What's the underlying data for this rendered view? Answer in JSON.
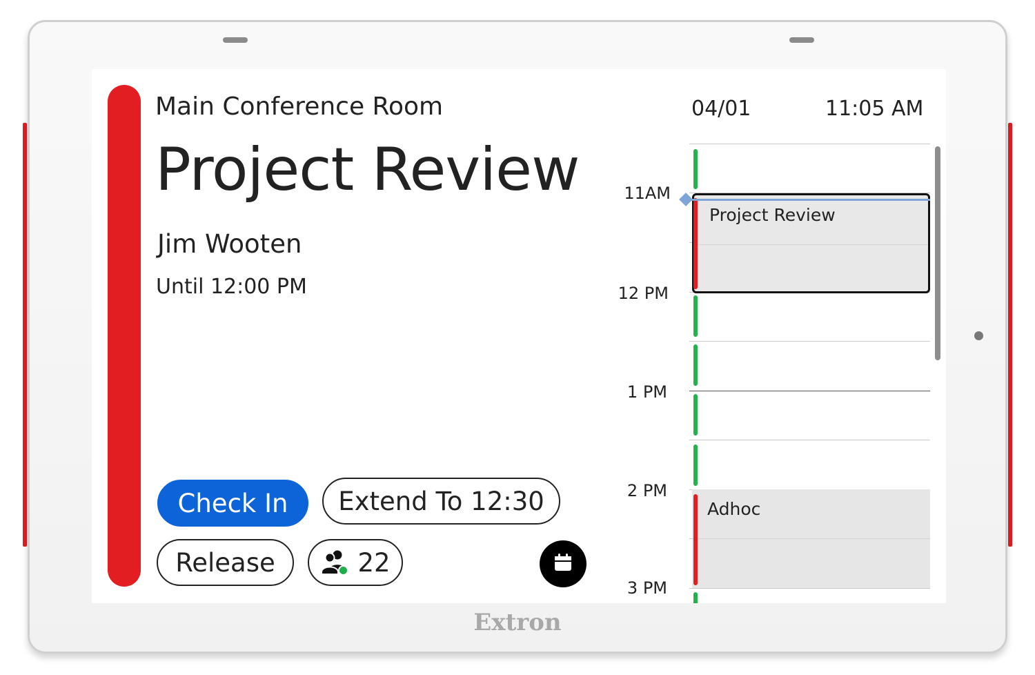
{
  "device": {
    "brand": "Extron",
    "led_color": "#e21e23"
  },
  "room": {
    "name": "Main Conference Room"
  },
  "meeting": {
    "title": "Project Review",
    "organizer": "Jim Wooten",
    "until": "Until 12:00 PM"
  },
  "actions": {
    "check_in": "Check In",
    "extend": "Extend To 12:30",
    "release": "Release",
    "attendees_count": "22"
  },
  "icons": {
    "attendees": "people-check-icon",
    "calendar": "calendar-icon"
  },
  "header": {
    "date": "04/01",
    "time": "11:05 AM"
  },
  "schedule": {
    "hours": [
      "11AM",
      "12 PM",
      "1 PM",
      "2 PM",
      "3 PM"
    ],
    "events": [
      {
        "title": "Project Review",
        "start": "11:00 AM",
        "end": "12:00 PM",
        "selected": true
      },
      {
        "title": "Adhoc",
        "start": "2:00 PM",
        "end": "3:00 PM",
        "selected": false
      }
    ],
    "current_time": "11:05 AM"
  },
  "colors": {
    "busy": "#e21e23",
    "free": "#22b14c",
    "primary": "#0c64d8",
    "now": "#7ea4d8"
  }
}
